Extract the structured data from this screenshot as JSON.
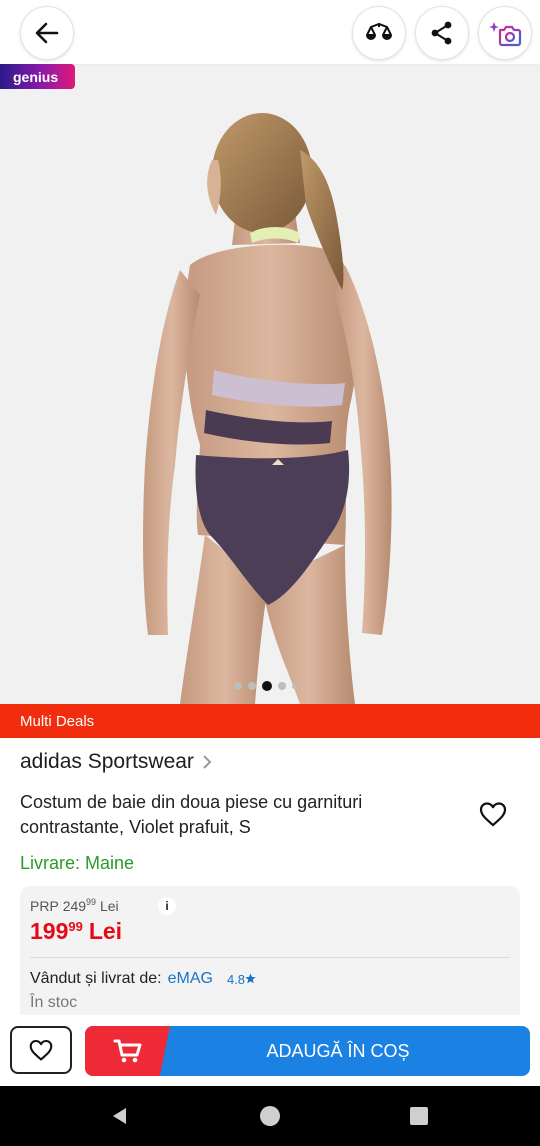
{
  "genius_badge": "genius",
  "multi_deals": "Multi Deals",
  "brand": "adidas Sportswear",
  "title": "Costum de baie din doua piese cu garnituri contrastante, Violet prafuit, S",
  "delivery": "Livrare: Maine",
  "prp": {
    "label": "PRP",
    "int": "249",
    "dec": "99",
    "currency": "Lei"
  },
  "price": {
    "int": "199",
    "dec": "99",
    "currency": "Lei"
  },
  "info_icon": "i",
  "seller": {
    "label": "Vândut și livrat de:",
    "name": "eMAG",
    "rating": "4.8"
  },
  "stock": "În stoc",
  "cart_button_label": "ADAUGĂ ÎN COȘ",
  "carousel": {
    "total": 5,
    "active": 2
  },
  "icons": {
    "back": "arrow-left-icon",
    "compare": "compare-icon",
    "share": "share-icon",
    "camera_search": "camera-sparkle-icon",
    "favorite": "heart-icon",
    "cart": "cart-icon",
    "rating_star": "star-icon",
    "brand_chevron": "chevron-right-icon"
  },
  "colors": {
    "accent_red": "#f12d0e",
    "price_red": "#e50b16",
    "delivery_green": "#2b9b2b",
    "link_blue": "#1a73c9",
    "cart_blue": "#1b82e3"
  }
}
